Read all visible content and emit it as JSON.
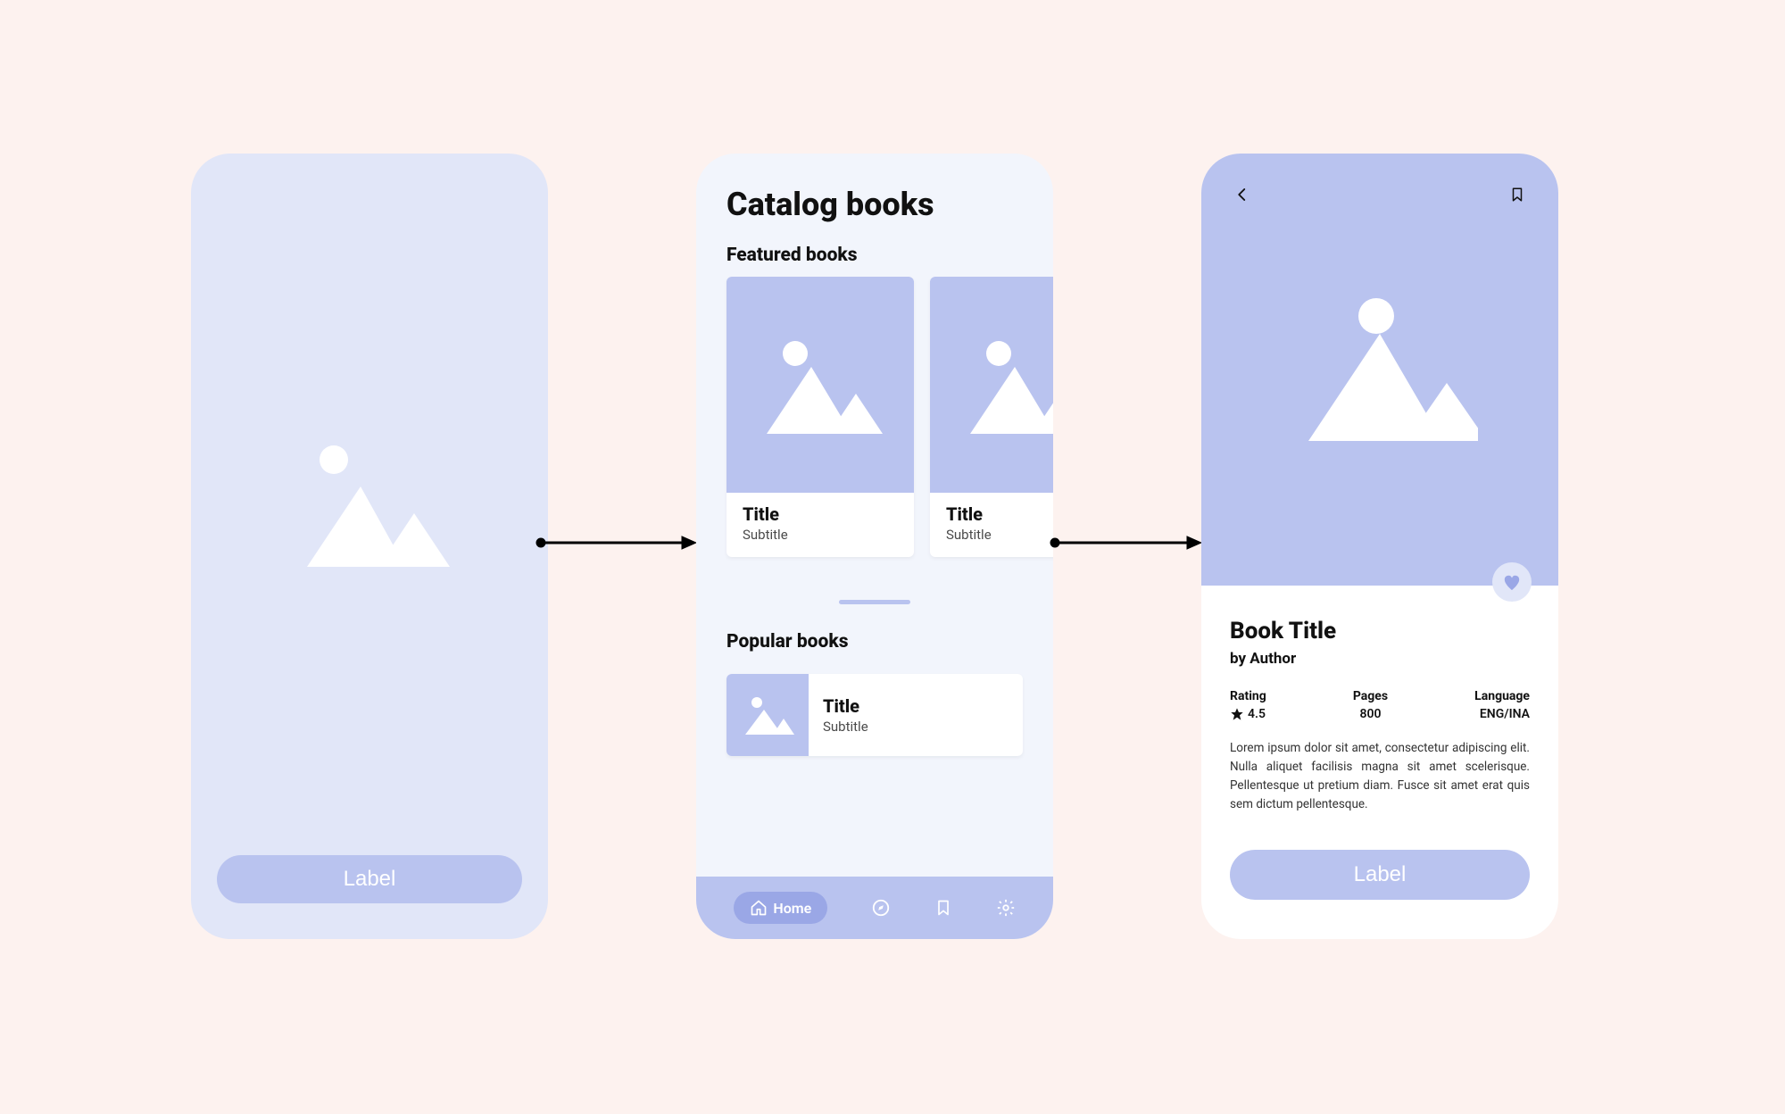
{
  "screen1": {
    "button_label": "Label"
  },
  "screen2": {
    "title": "Catalog books",
    "featured_heading": "Featured books",
    "featured": [
      {
        "title": "Title",
        "subtitle": "Subtitle"
      },
      {
        "title": "Title",
        "subtitle": "Subtitle"
      }
    ],
    "popular_heading": "Popular books",
    "popular": [
      {
        "title": "Title",
        "subtitle": "Subtitle"
      }
    ],
    "tabs": {
      "home": "Home"
    }
  },
  "screen3": {
    "book_title": "Book Title",
    "by_author": "by Author",
    "rating_label": "Rating",
    "rating_value": "4.5",
    "pages_label": "Pages",
    "pages_value": "800",
    "language_label": "Language",
    "language_value": "ENG/INA",
    "description": "Lorem ipsum dolor sit amet, consectetur adipiscing elit. Nulla aliquet facilisis magna sit amet scelerisque. Pellentesque ut pretium diam. Fusce sit amet erat quis sem dictum pellentesque.",
    "button_label": "Label"
  }
}
